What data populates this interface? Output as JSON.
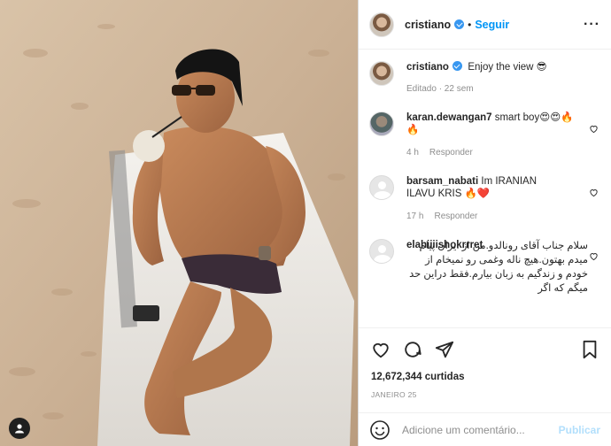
{
  "post": {
    "username": "cristiano",
    "follow_label": "Seguir",
    "more_icon": "more-options-icon",
    "caption": "Enjoy the view 😎",
    "caption_meta": "Editado · 22 sem"
  },
  "comments": [
    {
      "user": "karan.dewangan7",
      "text": "smart boy😍😍🔥🔥",
      "time": "4 h",
      "reply": "Responder"
    },
    {
      "user": "barsam_nabati",
      "text": "Im IRANIAN ILAVU KRIS 🔥❤️",
      "time": "17 h",
      "reply": "Responder"
    },
    {
      "user": "elahiiiishokrrret",
      "text": "سلام جناب آقای رونالدو.من از ایران پیام میدم بهتون.هیچ ناله وغمی رو نمیخام از خودم و زندگیم به زبان بیارم.فقط دراین حد میگم که اگر"
    }
  ],
  "footer": {
    "likes": "12,672,344 curtidas",
    "date": "JANEIRO 25",
    "comment_placeholder": "Adicione um comentário...",
    "post_label": "Publicar"
  },
  "colors": {
    "accent": "#0095f6",
    "verified": "#3897f0",
    "muted": "#8e8e8e"
  }
}
